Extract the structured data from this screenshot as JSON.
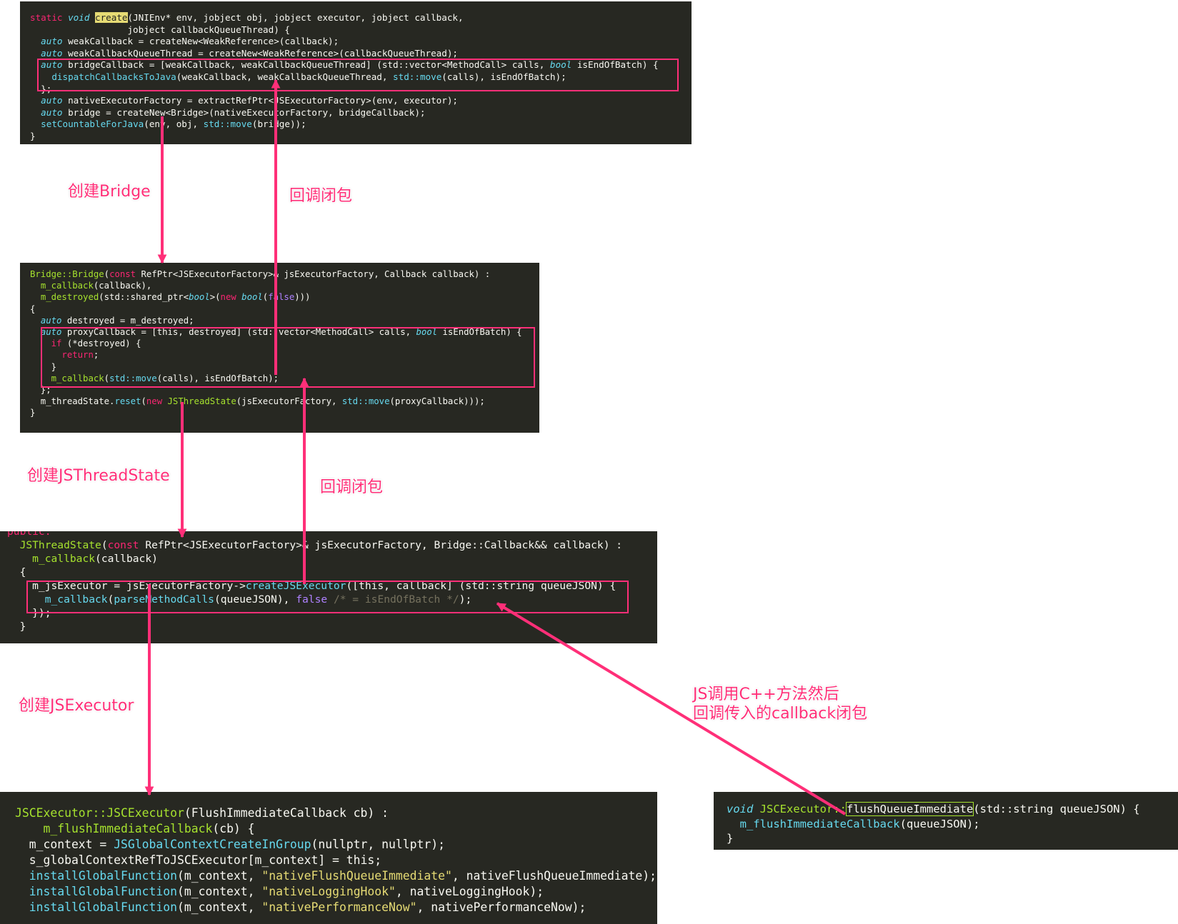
{
  "panels": {
    "bridge_create": {
      "lines": [
        [
          [
            "static ",
            "kw"
          ],
          [
            "void ",
            "ty"
          ],
          [
            "create",
            "hl-yellow"
          ],
          [
            "(JNIEnv* env, jobject obj, jobject executor, jobject callback,",
            ""
          ]
        ],
        [
          [
            "                  jobject callbackQueueThread) {",
            ""
          ]
        ],
        [
          [
            "  ",
            ""
          ],
          [
            "auto ",
            "ty"
          ],
          [
            "weakCallback = createNew<WeakReference>(callback);",
            ""
          ]
        ],
        [
          [
            "  ",
            ""
          ],
          [
            "auto ",
            "ty"
          ],
          [
            "weakCallbackQueueThread = createNew<WeakReference>(callbackQueueThread);",
            ""
          ]
        ],
        [
          [
            "  ",
            ""
          ],
          [
            "auto ",
            "ty"
          ],
          [
            "bridgeCallback = [weakCallback, weakCallbackQueueThread] (std::vector<MethodCall> calls, ",
            ""
          ],
          [
            "bool ",
            "ty"
          ],
          [
            "isEndOfBatch) {",
            ""
          ]
        ],
        [
          [
            "    ",
            ""
          ],
          [
            "dispatchCallbacksToJava",
            "fn"
          ],
          [
            "(weakCallback, weakCallbackQueueThread, ",
            ""
          ],
          [
            "std::move",
            "fn"
          ],
          [
            "(calls), isEndOfBatch);",
            ""
          ]
        ],
        [
          [
            "  };",
            ""
          ]
        ],
        [
          [
            "  ",
            ""
          ],
          [
            "auto ",
            "ty"
          ],
          [
            "nativeExecutorFactory = extractRefPtr<JSExecutorFactory>(env, executor);",
            ""
          ]
        ],
        [
          [
            "  ",
            ""
          ],
          [
            "auto ",
            "ty"
          ],
          [
            "bridge = createNew<Bridge>(nativeExecutorFactory, bridgeCallback);",
            ""
          ]
        ],
        [
          [
            "  ",
            ""
          ],
          [
            "setCountableForJava",
            "fn"
          ],
          [
            "(env, obj, ",
            ""
          ],
          [
            "std::move",
            "fn"
          ],
          [
            "(bridge));",
            ""
          ]
        ],
        [
          [
            "}",
            ""
          ]
        ]
      ]
    },
    "bridge_ctor": {
      "lines": [
        [
          [
            "Bridge::Bridge",
            "cls"
          ],
          [
            "(",
            ""
          ],
          [
            "const ",
            "kw"
          ],
          [
            "RefPtr<JSExecutorFactory>& jsExecutorFactory, Callback callback) :",
            ""
          ]
        ],
        [
          [
            "  ",
            ""
          ],
          [
            "m_callback",
            "cls"
          ],
          [
            "(callback),",
            ""
          ]
        ],
        [
          [
            "  ",
            ""
          ],
          [
            "m_destroyed",
            "cls"
          ],
          [
            "(std::shared_ptr<",
            ""
          ],
          [
            "bool",
            "ty"
          ],
          [
            ">(",
            ""
          ],
          [
            "new ",
            "kw"
          ],
          [
            "bool",
            "ty"
          ],
          [
            "(",
            ""
          ],
          [
            "false",
            "pu"
          ],
          [
            ")))",
            ""
          ]
        ],
        [
          [
            "{",
            ""
          ]
        ],
        [
          [
            "  ",
            ""
          ],
          [
            "auto ",
            "ty"
          ],
          [
            "destroyed = m_destroyed;",
            ""
          ]
        ],
        [
          [
            "  ",
            ""
          ],
          [
            "auto ",
            "ty"
          ],
          [
            "proxyCallback = [this, destroyed] (std::vector<MethodCall> calls, ",
            ""
          ],
          [
            "bool ",
            "ty"
          ],
          [
            "isEndOfBatch) {",
            ""
          ]
        ],
        [
          [
            "    ",
            ""
          ],
          [
            "if ",
            "kw"
          ],
          [
            "(*destroyed) {",
            ""
          ]
        ],
        [
          [
            "      ",
            ""
          ],
          [
            "return",
            "kw"
          ],
          [
            ";",
            ""
          ]
        ],
        [
          [
            "    }",
            ""
          ]
        ],
        [
          [
            "    ",
            ""
          ],
          [
            "m_callback",
            "cls"
          ],
          [
            "(",
            ""
          ],
          [
            "std::move",
            "fn"
          ],
          [
            "(calls), isEndOfBatch);",
            ""
          ]
        ],
        [
          [
            "  };",
            ""
          ]
        ],
        [
          [
            "  m_threadState.",
            ""
          ],
          [
            "reset",
            "fn"
          ],
          [
            "(",
            ""
          ],
          [
            "new ",
            "kw"
          ],
          [
            "JSThreadState",
            "cls"
          ],
          [
            "(jsExecutorFactory, ",
            ""
          ],
          [
            "std::move",
            "fn"
          ],
          [
            "(proxyCallback)));",
            ""
          ]
        ],
        [
          [
            "}",
            ""
          ]
        ]
      ]
    },
    "jsthreadstate_ctor": {
      "clipped_line": [
        [
          "public:",
          "kw"
        ]
      ],
      "lines": [
        [
          [
            "  ",
            ""
          ],
          [
            "JSThreadState",
            "cls"
          ],
          [
            "(",
            ""
          ],
          [
            "const ",
            "kw"
          ],
          [
            "RefPtr<JSExecutorFactory>& jsExecutorFactory, Bridge::Callback&& callback) :",
            ""
          ]
        ],
        [
          [
            "    ",
            ""
          ],
          [
            "m_callback",
            "cls"
          ],
          [
            "(callback)",
            ""
          ]
        ],
        [
          [
            "  {",
            ""
          ]
        ],
        [
          [
            "    m_jsExecutor = jsExecutorFactory->",
            ""
          ],
          [
            "createJSExecutor",
            "fn"
          ],
          [
            "([this, callback] (std::string queueJSON) {",
            ""
          ]
        ],
        [
          [
            "      ",
            ""
          ],
          [
            "m_callback",
            "fn"
          ],
          [
            "(",
            ""
          ],
          [
            "parseMethodCalls",
            "fn"
          ],
          [
            "(queueJSON), ",
            ""
          ],
          [
            "false ",
            "pu"
          ],
          [
            "/* = isEndOfBatch */",
            "cm"
          ],
          [
            ");",
            ""
          ]
        ],
        [
          [
            "    });",
            ""
          ]
        ],
        [
          [
            "  }",
            ""
          ]
        ]
      ]
    },
    "jsexecutor_ctor": {
      "lines": [
        [
          [
            "JSCExecutor::JSCExecutor",
            "cls"
          ],
          [
            "(FlushImmediateCallback cb) :",
            ""
          ]
        ],
        [
          [
            "    ",
            ""
          ],
          [
            "m_flushImmediateCallback",
            "cls"
          ],
          [
            "(cb) {",
            ""
          ]
        ],
        [
          [
            "  m_context = ",
            ""
          ],
          [
            "JSGlobalContextCreateInGroup",
            "fn"
          ],
          [
            "(nullptr, nullptr);",
            ""
          ]
        ],
        [
          [
            "  s_globalContextRefToJSCExecutor[m_context] = this;",
            ""
          ]
        ],
        [
          [
            "  ",
            ""
          ],
          [
            "installGlobalFunction",
            "fn"
          ],
          [
            "(m_context, ",
            ""
          ],
          [
            "\"nativeFlushQueueImmediate\"",
            "st"
          ],
          [
            ", nativeFlushQueueImmediate);",
            ""
          ]
        ],
        [
          [
            "  ",
            ""
          ],
          [
            "installGlobalFunction",
            "fn"
          ],
          [
            "(m_context, ",
            ""
          ],
          [
            "\"nativeLoggingHook\"",
            "st"
          ],
          [
            ", nativeLoggingHook);",
            ""
          ]
        ],
        [
          [
            "  ",
            ""
          ],
          [
            "installGlobalFunction",
            "fn"
          ],
          [
            "(m_context, ",
            ""
          ],
          [
            "\"nativePerformanceNow\"",
            "st"
          ],
          [
            ", nativePerformanceNow);",
            ""
          ]
        ]
      ]
    },
    "flush_queue": {
      "lines": [
        [
          [
            "void ",
            "ty"
          ],
          [
            "JSCExecutor::",
            "cls"
          ],
          [
            "flushQueueImmediate",
            "hl-box"
          ],
          [
            "(std::string queueJSON) {",
            ""
          ]
        ],
        [
          [
            "  ",
            ""
          ],
          [
            "m_flushImmediateCallback",
            "fn"
          ],
          [
            "(queueJSON);",
            ""
          ]
        ],
        [
          [
            "}",
            ""
          ]
        ]
      ]
    }
  },
  "labels": {
    "create_bridge": "创建Bridge",
    "callback_closure_1": "回调闭包",
    "create_jsthreadstate": "创建JSThreadState",
    "callback_closure_2": "回调闭包",
    "create_jsexecutor": "创建JSExecutor",
    "js_call_note_line1": "JS调用C++方法然后",
    "js_call_note_line2": "回调传入的callback闭包"
  },
  "colors": {
    "arrow": "#ff2f78",
    "panel_bg": "#272822"
  }
}
